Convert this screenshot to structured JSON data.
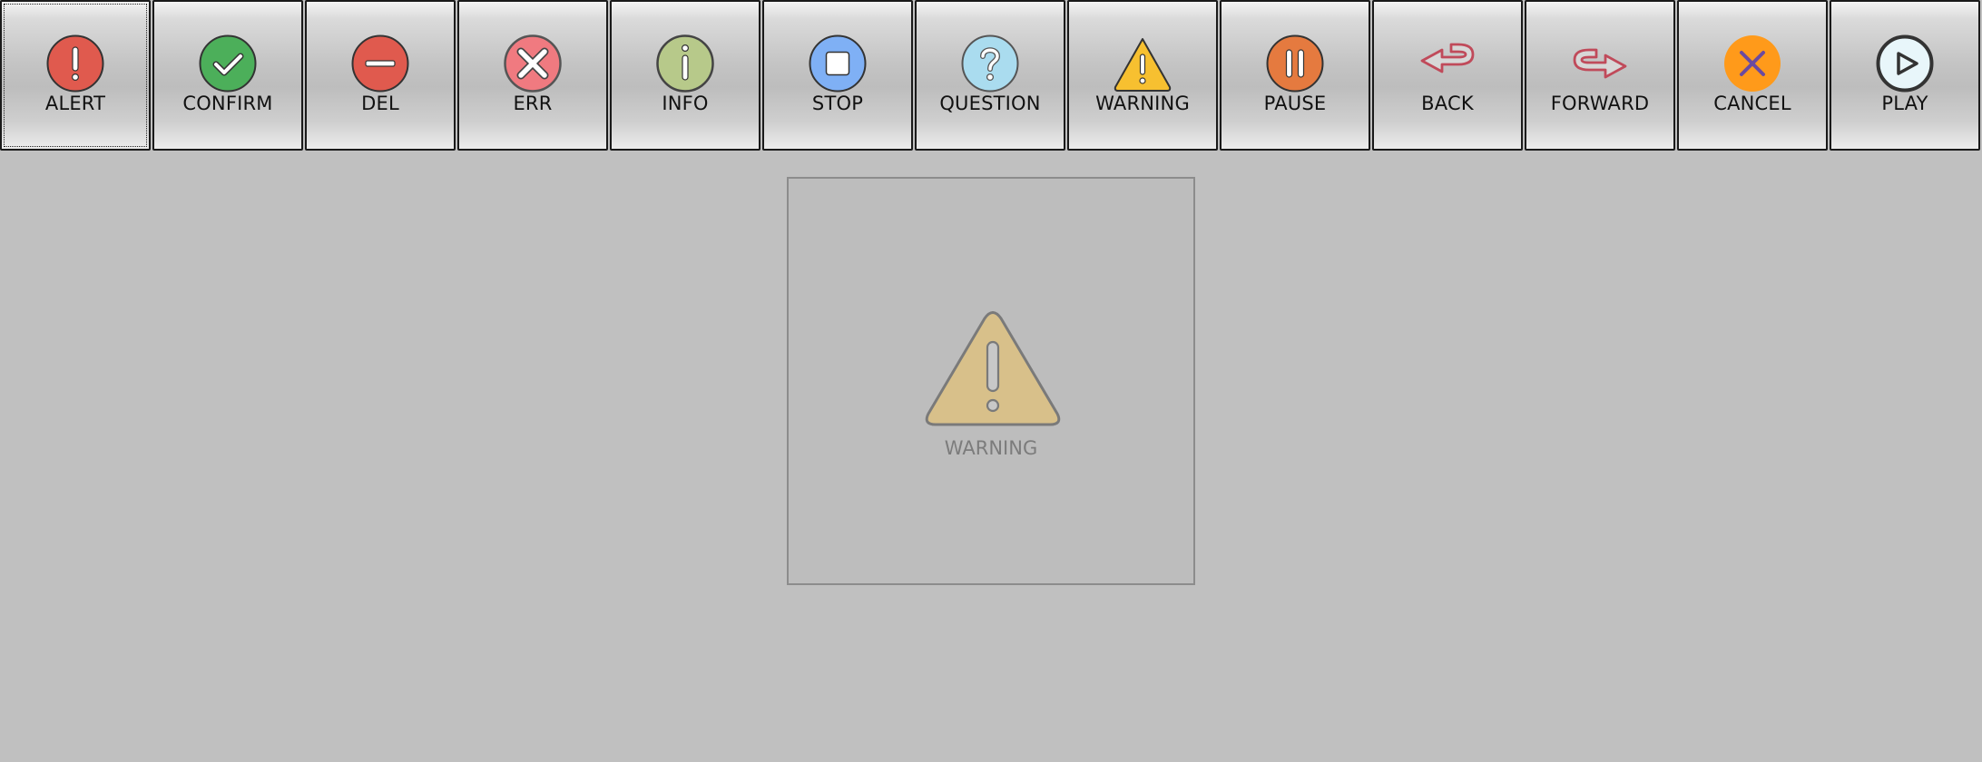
{
  "toolbar": {
    "buttons": [
      {
        "label": "ALERT",
        "icon": "alert-icon",
        "color": "#e05a4e"
      },
      {
        "label": "CONFIRM",
        "icon": "check-icon",
        "color": "#4caf5a"
      },
      {
        "label": "DEL",
        "icon": "minus-icon",
        "color": "#e05a4e"
      },
      {
        "label": "ERR",
        "icon": "x-circle-icon",
        "color": "#f07a80"
      },
      {
        "label": "INFO",
        "icon": "info-icon",
        "color": "#b7c98a"
      },
      {
        "label": "STOP",
        "icon": "stop-icon",
        "color": "#7fb0f5"
      },
      {
        "label": "QUESTION",
        "icon": "question-icon",
        "color": "#aadcef"
      },
      {
        "label": "WARNING",
        "icon": "warning-icon",
        "color": "#f7c030"
      },
      {
        "label": "PAUSE",
        "icon": "pause-icon",
        "color": "#e57a3f"
      },
      {
        "label": "BACK",
        "icon": "back-arrow-icon",
        "color": "#c04a5a"
      },
      {
        "label": "FORWARD",
        "icon": "forward-arrow-icon",
        "color": "#c04a5a"
      },
      {
        "label": "CANCEL",
        "icon": "cancel-icon",
        "color": "#ff9a1a"
      },
      {
        "label": "PLAY",
        "icon": "play-icon",
        "color": "#e8f6fa"
      }
    ]
  },
  "preview": {
    "label": "WARNING",
    "icon": "warning-icon",
    "color": "#d8c08a"
  }
}
